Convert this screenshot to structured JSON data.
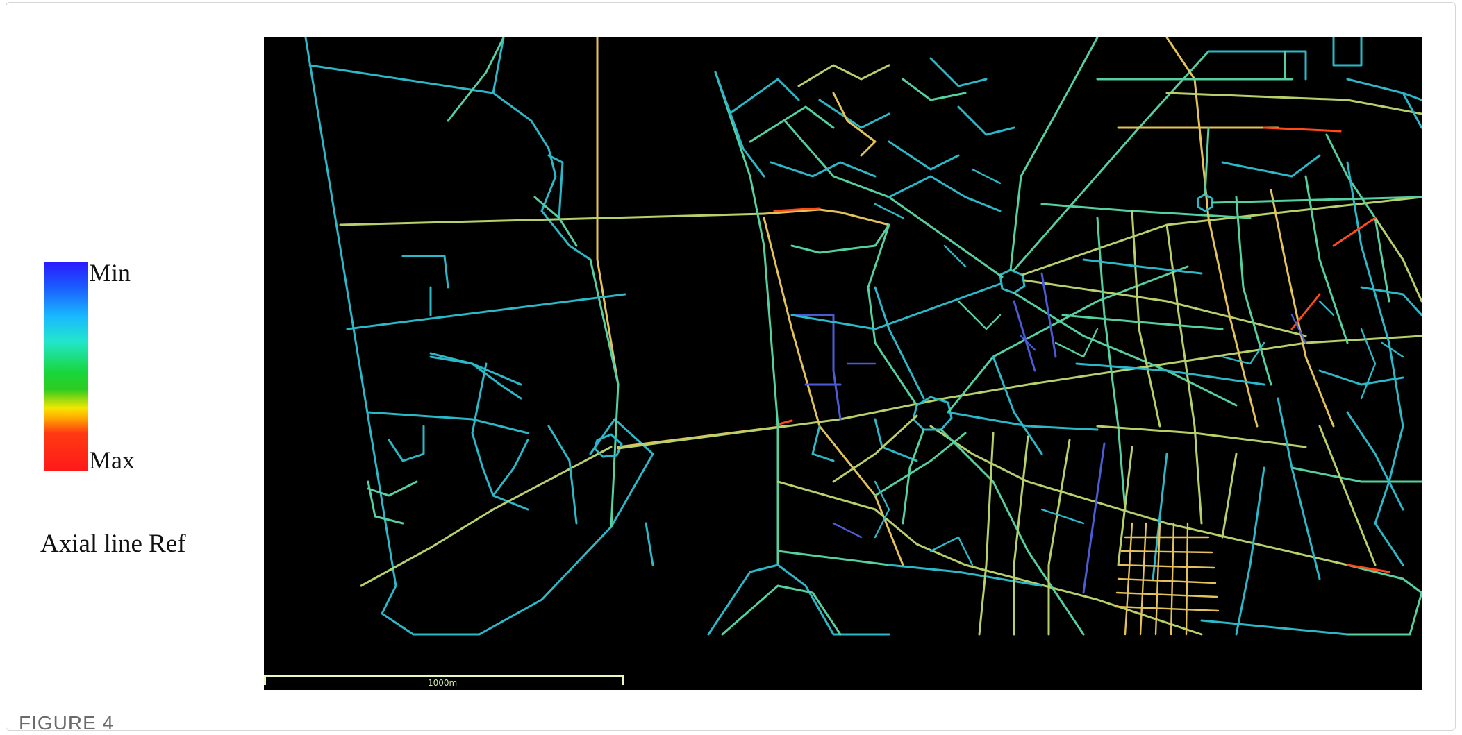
{
  "figure": {
    "label": "FIGURE 4"
  },
  "legend": {
    "min_label": "Min",
    "max_label": "Max",
    "colors": [
      "#2a1bff",
      "#19b9ff",
      "#22e6cc",
      "#18d63a",
      "#f5e600",
      "#ffb400",
      "#ff1a1a"
    ]
  },
  "caption": {
    "text": "Axial line Ref"
  },
  "map": {
    "background": "#000000",
    "scale_bar_label": "1000m",
    "palette": {
      "min": "#4b5bd6",
      "low": "#2bb8c8",
      "mid": "#55d0a0",
      "midhigh": "#b8d06a",
      "high": "#e3c25a",
      "max": "#ff4a1a"
    }
  }
}
